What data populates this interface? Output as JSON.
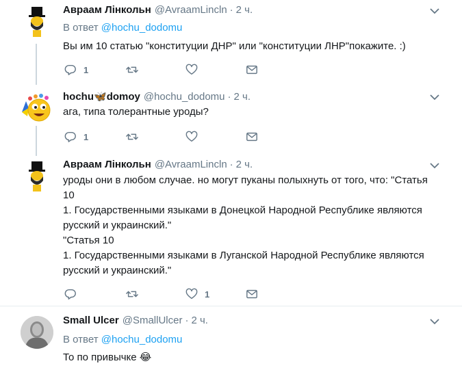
{
  "tweets": [
    {
      "name": "Авраам Лінкольн",
      "handle": "@AvraamLincln",
      "separator": "·",
      "time": "2 ч.",
      "reply_prefix": "В ответ",
      "reply_to": "@hochu_dodomu",
      "text": "Вы им 10 статью \"конституции ДНР\" или \"конституции ЛНР\"покажите. :)",
      "reply_count": "1",
      "retweet_count": "",
      "like_count": ""
    },
    {
      "name_part1": "hochu",
      "name_emoji": "🦋",
      "name_part2": "domoy",
      "handle": "@hochu_dodomu",
      "separator": "·",
      "time": "2 ч.",
      "text": "ага, типа толерантные уроды?",
      "reply_count": "1",
      "retweet_count": "",
      "like_count": ""
    },
    {
      "name": "Авраам Лінкольн",
      "handle": "@AvraamLincln",
      "separator": "·",
      "time": "2 ч.",
      "text": "уроды они в любом случае. но могут пуканы полыхнуть от того, что: \"Статья 10\n1. Государственными языками в Донецкой Народной Республике являются русский и украинский.\"\n\"Статья 10\n1. Государственными языками в Луганской Народной Республике являются русский и украинский.\"",
      "reply_count": "",
      "retweet_count": "",
      "like_count": "1"
    },
    {
      "name": "Small Ulcer",
      "handle": "@SmallUlcer",
      "separator": "·",
      "time": "2 ч.",
      "reply_prefix": "В ответ",
      "reply_to": "@hochu_dodomu",
      "text": "То по привычке 😂"
    }
  ],
  "colors": {
    "accent": "#1da1f2",
    "secondary_text": "#657786",
    "thread_line": "#ccd6dd",
    "divider": "#e6ecf0"
  },
  "icons": [
    "lincoln-avatar-icon",
    "emoji-avatar-icon",
    "user-avatar-icon",
    "chevron-down-icon",
    "reply-icon",
    "retweet-icon",
    "like-icon",
    "message-icon"
  ]
}
